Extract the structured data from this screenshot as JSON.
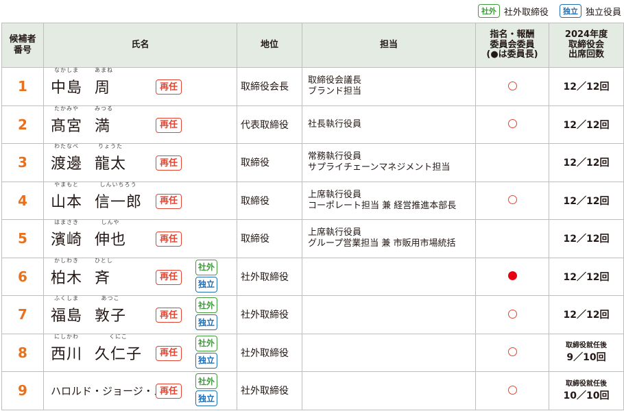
{
  "legend": {
    "outside_badge": "社外",
    "outside_label": "社外取締役",
    "independent_badge": "独立",
    "independent_label": "独立役員"
  },
  "headers": {
    "no": "候補者\n番号",
    "name": "氏名",
    "position": "地位",
    "responsibility": "担当",
    "committee": "指名・報酬\n委員会委員\n(●は委員長)",
    "attendance": "2024年度\n取締役会\n出席回数"
  },
  "reappoint_badge": "再任",
  "candidates": [
    {
      "no": "1",
      "family": "中島",
      "given": "周",
      "family_ruby": "なかしま",
      "given_ruby": "あまね",
      "position": "取締役会長",
      "resp": "取締役会議長\nブランド担当",
      "committee": "○",
      "attendance": "12／12回",
      "note": "",
      "outside": false,
      "independent": false
    },
    {
      "no": "2",
      "family": "髙宮",
      "given": "満",
      "family_ruby": "たかみや",
      "given_ruby": "みつる",
      "position": "代表取締役",
      "resp": "社長執行役員",
      "committee": "○",
      "attendance": "12／12回",
      "note": "",
      "outside": false,
      "independent": false
    },
    {
      "no": "3",
      "family": "渡邊",
      "given": "龍太",
      "family_ruby": "わたなべ",
      "given_ruby": "りょうた",
      "position": "取締役",
      "resp": "常務執行役員\nサプライチェーンマネジメント担当",
      "committee": "",
      "attendance": "12／12回",
      "note": "",
      "outside": false,
      "independent": false
    },
    {
      "no": "4",
      "family": "山本",
      "given": "信一郎",
      "family_ruby": "やまもと",
      "given_ruby": "しんいちろう",
      "position": "取締役",
      "resp": "上席執行役員\nコーポレート担当 兼 経営推進本部長",
      "committee": "○",
      "attendance": "12／12回",
      "note": "",
      "outside": false,
      "independent": false
    },
    {
      "no": "5",
      "family": "濱崎",
      "given": "伸也",
      "family_ruby": "はまさき",
      "given_ruby": "しんや",
      "position": "取締役",
      "resp": "上席執行役員\nグループ営業担当 兼 市販用市場統括",
      "committee": "",
      "attendance": "12／12回",
      "note": "",
      "outside": false,
      "independent": false
    },
    {
      "no": "6",
      "family": "柏木",
      "given": "斉",
      "family_ruby": "かしわき",
      "given_ruby": "ひとし",
      "position": "社外取締役",
      "resp": "",
      "committee": "●",
      "attendance": "12／12回",
      "note": "",
      "outside": true,
      "independent": true
    },
    {
      "no": "7",
      "family": "福島",
      "given": "敦子",
      "family_ruby": "ふくしま",
      "given_ruby": "あつこ",
      "position": "社外取締役",
      "resp": "",
      "committee": "○",
      "attendance": "12／12回",
      "note": "",
      "outside": true,
      "independent": true
    },
    {
      "no": "8",
      "family": "西川",
      "given": "久仁子",
      "family_ruby": "にしかわ",
      "given_ruby": "くにこ",
      "position": "社外取締役",
      "resp": "",
      "committee": "○",
      "attendance": "9／10回",
      "note": "取締役就任後",
      "outside": true,
      "independent": true
    },
    {
      "no": "9",
      "family": "ハロルド・ジョージ・メイ",
      "given": "",
      "family_ruby": "",
      "given_ruby": "",
      "position": "社外取締役",
      "resp": "",
      "committee": "○",
      "attendance": "10／10回",
      "note": "取締役就任後",
      "outside": true,
      "independent": true
    }
  ]
}
